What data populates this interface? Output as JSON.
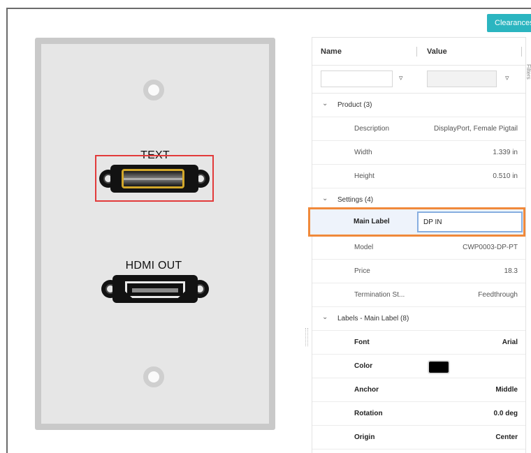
{
  "toolbar": {
    "clearances_label": "Clearances"
  },
  "canvas": {
    "connector_top_label": "TEXT",
    "connector_bottom_label": "HDMI OUT"
  },
  "grid": {
    "header_name": "Name",
    "header_value": "Value",
    "side_tab": "Filters",
    "name_filter_value": "",
    "value_filter_value": "",
    "groups": {
      "product": "Product (3)",
      "settings": "Settings (4)",
      "labels": "Labels - Main Label (8)"
    },
    "product_rows": [
      {
        "name": "Description",
        "value": "DisplayPort, Female Pigtail"
      },
      {
        "name": "Width",
        "value": "1.339 in"
      },
      {
        "name": "Height",
        "value": "0.510 in"
      }
    ],
    "edit_row": {
      "name": "Main Label",
      "value": "DP IN"
    },
    "settings_rows": [
      {
        "name": "Model",
        "value": "CWP0003-DP-PT"
      },
      {
        "name": "Price",
        "value": "18.3"
      },
      {
        "name": "Termination St...",
        "value": "Feedthrough"
      }
    ],
    "label_rows": [
      {
        "name": "Font",
        "value": "Arial"
      },
      {
        "name": "Color",
        "value": ""
      },
      {
        "name": "Anchor",
        "value": "Middle"
      },
      {
        "name": "Rotation",
        "value": "0.0 deg"
      },
      {
        "name": "Origin",
        "value": "Center"
      }
    ],
    "colors": {
      "label_color": "#000000",
      "accent": "#2bb5c0",
      "edit_highlight": "#f0893a",
      "selection": "#e23a3a"
    }
  }
}
